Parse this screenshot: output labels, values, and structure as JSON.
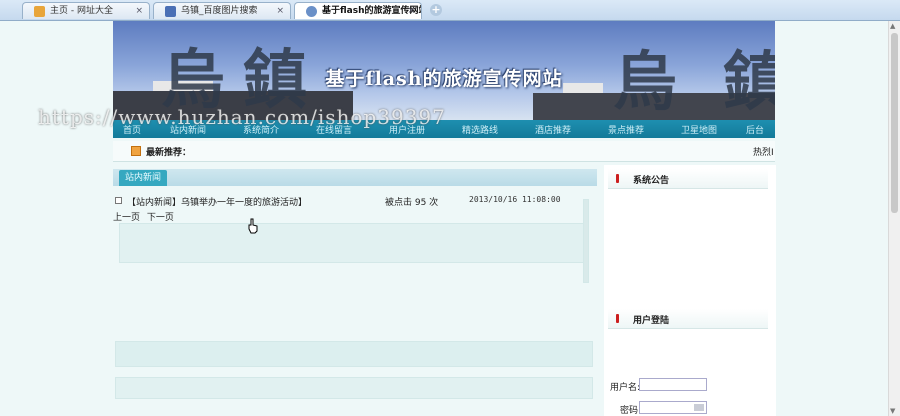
{
  "browser": {
    "tabs": [
      {
        "title": "主页 - 网址大全",
        "icon_color": "#e8a53a",
        "active": false,
        "close": "×"
      },
      {
        "title": "乌镇_百度图片搜索",
        "icon_color": "#4a6fb5",
        "active": false,
        "close": "×"
      },
      {
        "title": "基于flash的旅游宣传网站",
        "icon_color": "#6a90c8",
        "active": true,
        "close": "×"
      }
    ],
    "new_tab_symbol": "+"
  },
  "site": {
    "title": "基于flash的旅游宣传网站",
    "banner_glyphs": [
      "烏",
      "鎮",
      "烏",
      "鎮"
    ],
    "nav": [
      "首页",
      "站内新闻",
      "系统简介",
      "在线留言",
      "用户注册",
      "精选路线",
      "酒店推荐",
      "景点推荐",
      "卫星地图",
      "后台"
    ]
  },
  "ticker": {
    "label": "最新推荐：",
    "right_text": "热烈I"
  },
  "news": {
    "tab_label": "站内新闻",
    "items": [
      {
        "title": "【站内新闻】乌镇举办一年一度的旅游活动】",
        "clicks": "被点击 95 次",
        "date": "2013/10/16 11:08:00"
      }
    ],
    "prev": "上一页",
    "next": "下一页"
  },
  "sidebar": {
    "notice_title": "系统公告",
    "login_title": "用户登陆",
    "username_label": "用户名:",
    "password_label": "密码:"
  },
  "watermark": "https://www.huzhan.com/ishop39397",
  "colors": {
    "nav_bg": "#137a99",
    "tab_accent": "#35a8c0",
    "page_bg": "#eef8f8"
  }
}
